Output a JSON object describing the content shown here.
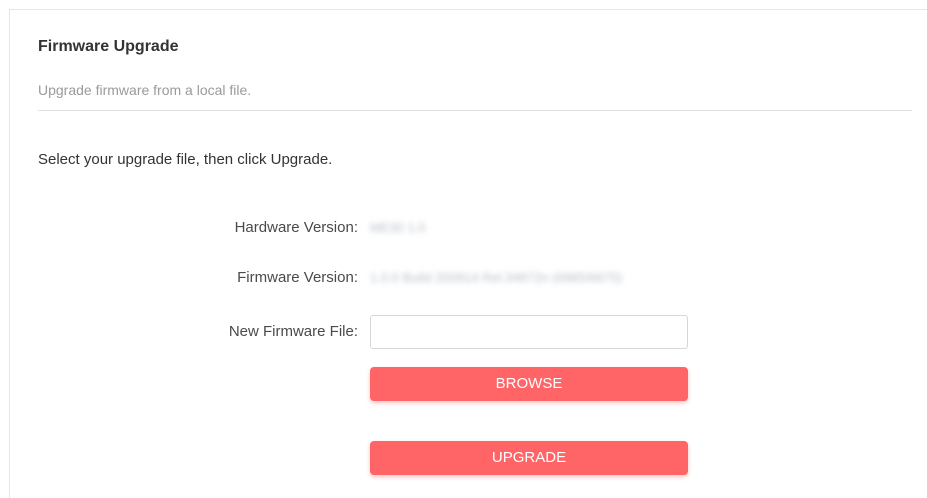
{
  "header": {
    "title": "Firmware Upgrade",
    "subtitle": "Upgrade firmware from a local file."
  },
  "instruction": "Select your upgrade file, then click Upgrade.",
  "info": {
    "hardware_label": "Hardware Version:",
    "hardware_value": "ME30 1.0",
    "firmware_label": "Firmware Version:",
    "firmware_value": "1.0.0 Build 200914 Rel.34872n (6985/6675)",
    "new_file_label": "New Firmware File:"
  },
  "file_input": {
    "value": "",
    "placeholder": ""
  },
  "buttons": {
    "browse_label": "BROWSE",
    "upgrade_label": "UPGRADE"
  },
  "colors": {
    "accent": "#ff6566",
    "title": "#333333",
    "subtitle": "#9a9a9a"
  }
}
